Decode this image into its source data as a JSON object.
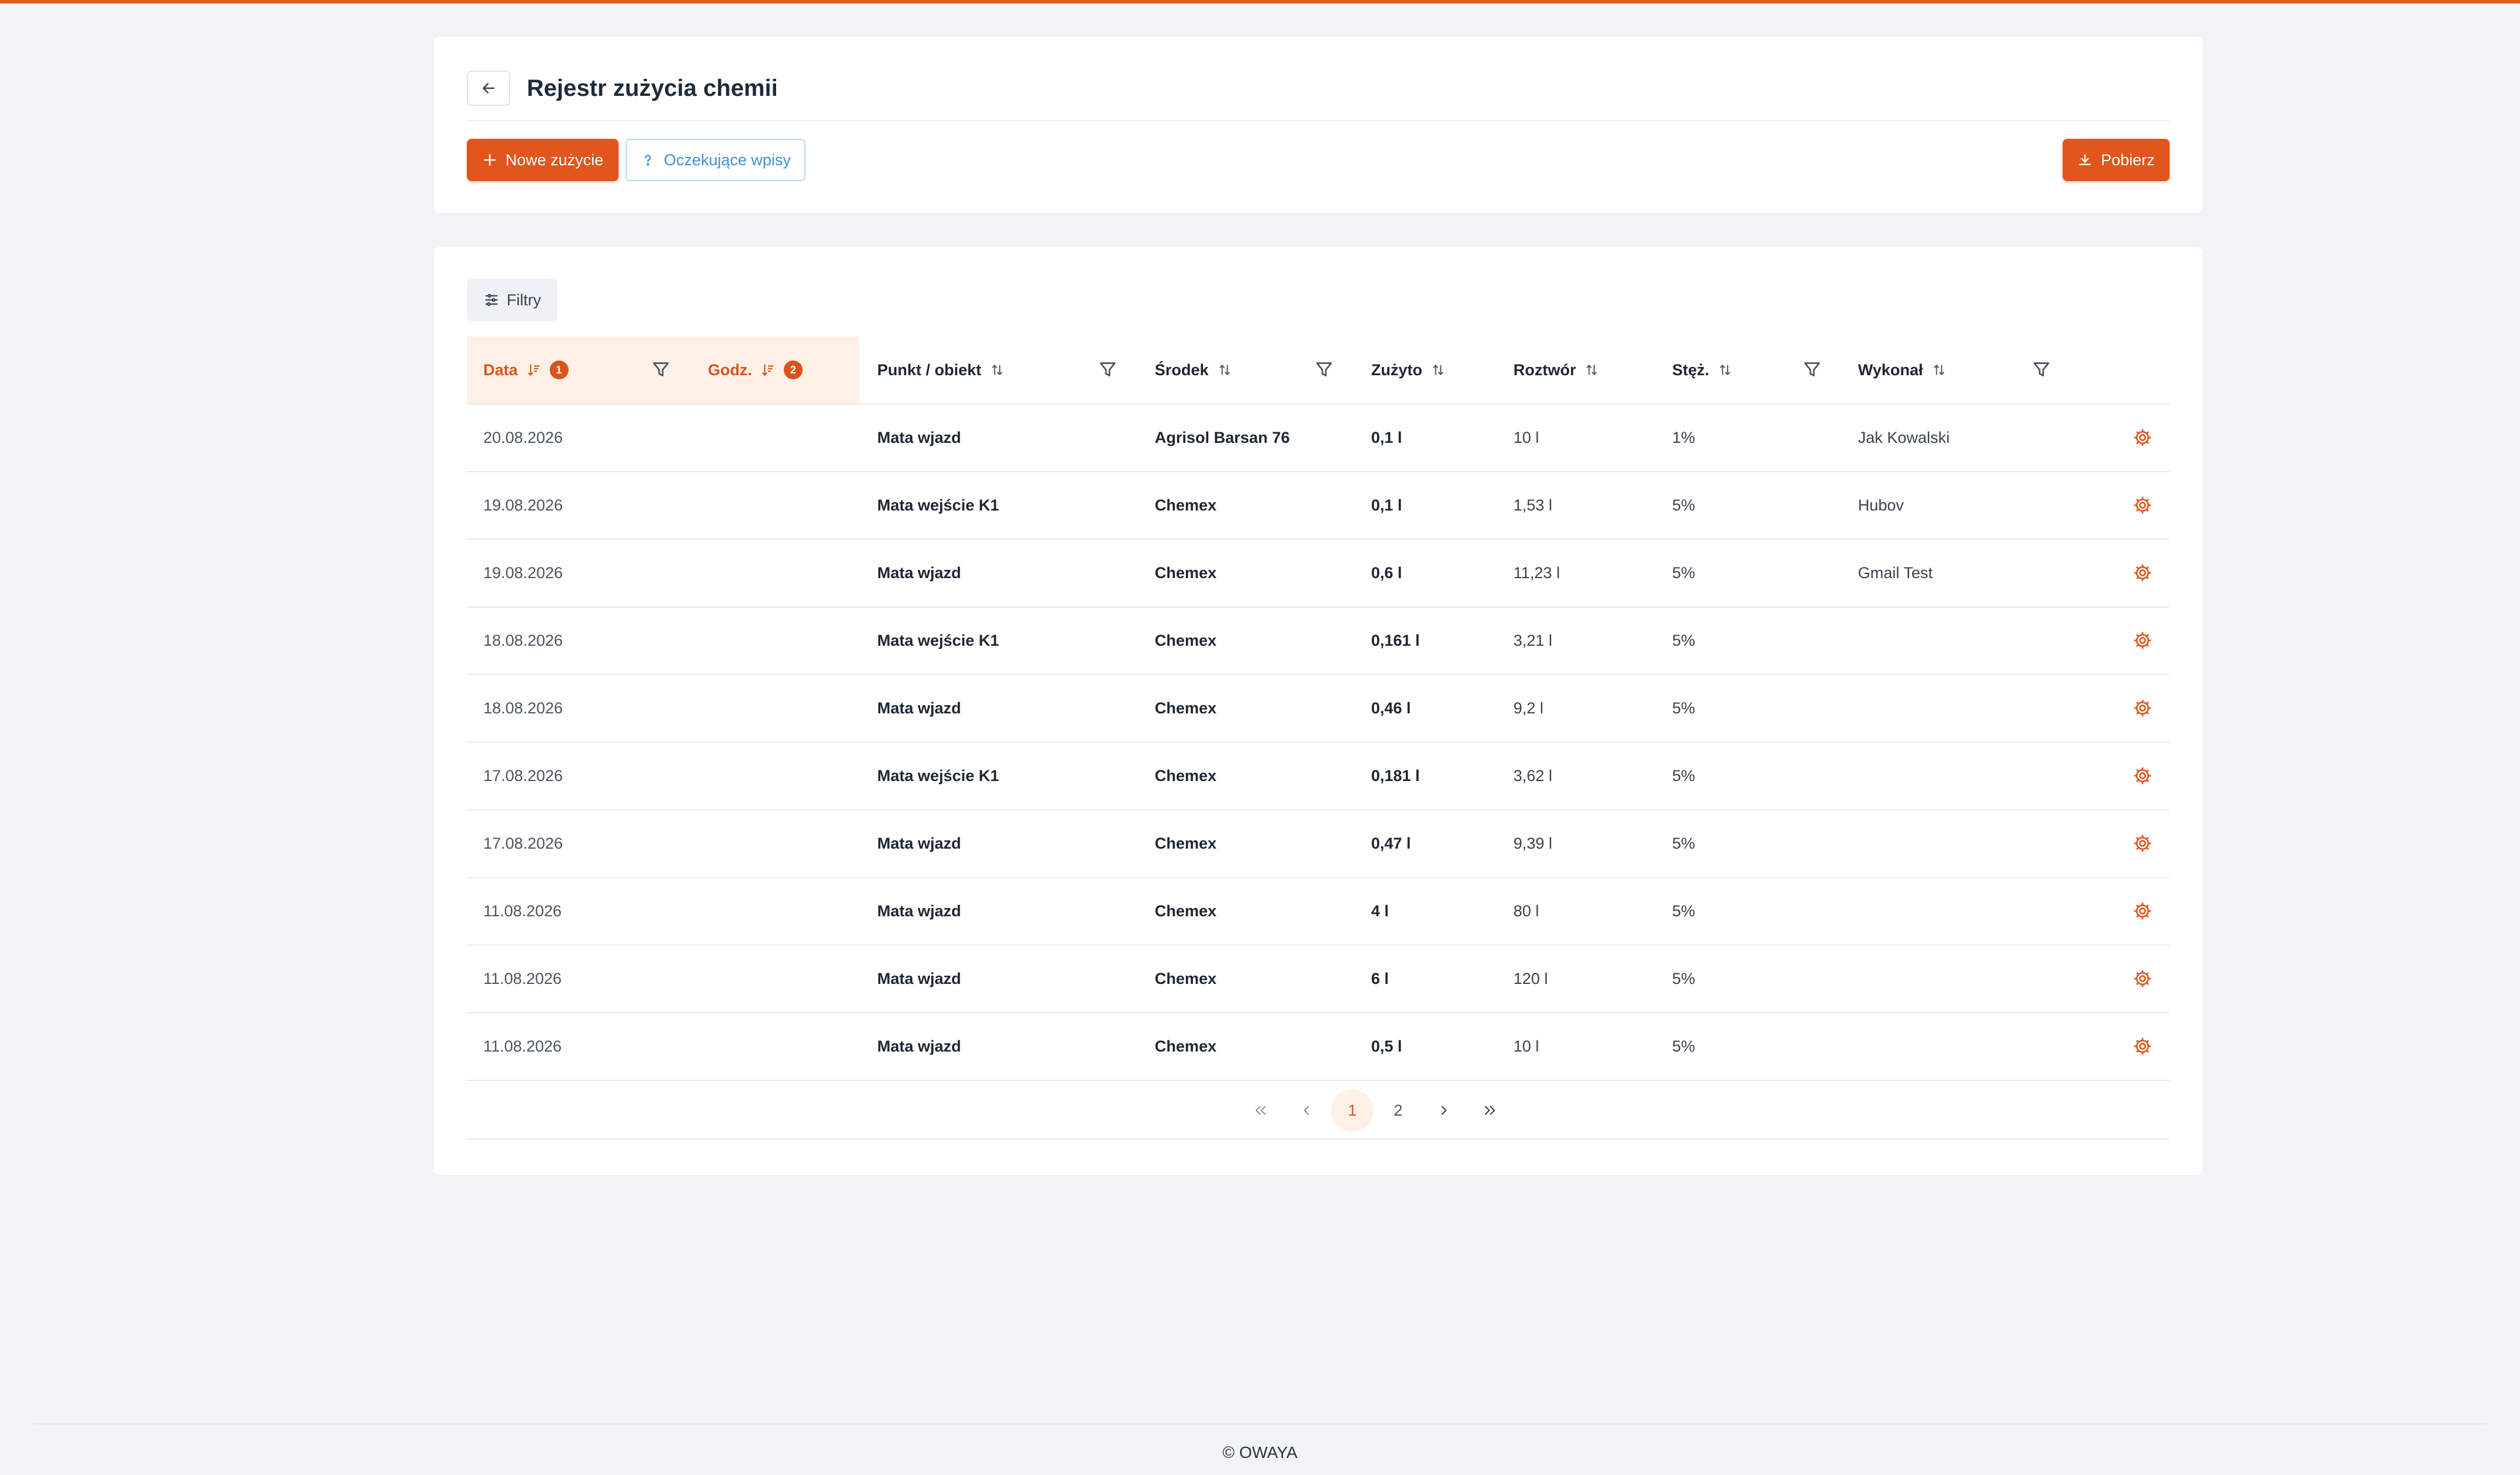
{
  "header": {
    "title": "Rejestr zużycia chemii",
    "new_button": "Nowe zużycie",
    "pending_button": "Oczekujące wpisy",
    "download_button": "Pobierz"
  },
  "toolbar": {
    "filters_label": "Filtry"
  },
  "table": {
    "columns": {
      "date": "Data",
      "time": "Godz.",
      "point": "Punkt / obiekt",
      "agent": "Środek",
      "used": "Zużyto",
      "solution": "Roztwór",
      "concentration": "Stęż.",
      "performed_by": "Wykonał"
    },
    "sort_badges": {
      "date": "1",
      "time": "2"
    },
    "rows": [
      {
        "date": "20.08.2026",
        "time": "",
        "point": "Mata wjazd",
        "agent": "Agrisol Barsan 76",
        "used": "0,1 l",
        "solution": "10 l",
        "concentration": "1%",
        "performed_by": "Jak Kowalski"
      },
      {
        "date": "19.08.2026",
        "time": "",
        "point": "Mata wejście K1",
        "agent": "Chemex",
        "used": "0,1 l",
        "solution": "1,53 l",
        "concentration": "5%",
        "performed_by": "Hubov"
      },
      {
        "date": "19.08.2026",
        "time": "",
        "point": "Mata wjazd",
        "agent": "Chemex",
        "used": "0,6 l",
        "solution": "11,23 l",
        "concentration": "5%",
        "performed_by": "Gmail Test"
      },
      {
        "date": "18.08.2026",
        "time": "",
        "point": "Mata wejście K1",
        "agent": "Chemex",
        "used": "0,161 l",
        "solution": "3,21 l",
        "concentration": "5%",
        "performed_by": ""
      },
      {
        "date": "18.08.2026",
        "time": "",
        "point": "Mata wjazd",
        "agent": "Chemex",
        "used": "0,46 l",
        "solution": "9,2 l",
        "concentration": "5%",
        "performed_by": ""
      },
      {
        "date": "17.08.2026",
        "time": "",
        "point": "Mata wejście K1",
        "agent": "Chemex",
        "used": "0,181 l",
        "solution": "3,62 l",
        "concentration": "5%",
        "performed_by": ""
      },
      {
        "date": "17.08.2026",
        "time": "",
        "point": "Mata wjazd",
        "agent": "Chemex",
        "used": "0,47 l",
        "solution": "9,39 l",
        "concentration": "5%",
        "performed_by": ""
      },
      {
        "date": "11.08.2026",
        "time": "",
        "point": "Mata wjazd",
        "agent": "Chemex",
        "used": "4 l",
        "solution": "80 l",
        "concentration": "5%",
        "performed_by": ""
      },
      {
        "date": "11.08.2026",
        "time": "",
        "point": "Mata wjazd",
        "agent": "Chemex",
        "used": "6 l",
        "solution": "120 l",
        "concentration": "5%",
        "performed_by": ""
      },
      {
        "date": "11.08.2026",
        "time": "",
        "point": "Mata wjazd",
        "agent": "Chemex",
        "used": "0,5 l",
        "solution": "10 l",
        "concentration": "5%",
        "performed_by": ""
      }
    ]
  },
  "pagination": {
    "pages": [
      "1",
      "2"
    ],
    "current": "1"
  },
  "footer": {
    "copyright": "© OWAYA"
  },
  "colors": {
    "accent": "#e0561d",
    "topbar": "#e35d22",
    "sorted_header_bg": "#fdf1e7",
    "link_blue": "#3e8fd8"
  },
  "icons": {
    "back": "arrow-left-icon",
    "new": "plus-icon",
    "pending": "question-icon",
    "download": "download-icon",
    "filters": "sliders-icon",
    "sort": "sort-icon",
    "column_filter": "funnel-icon",
    "row_action": "gear-icon"
  }
}
